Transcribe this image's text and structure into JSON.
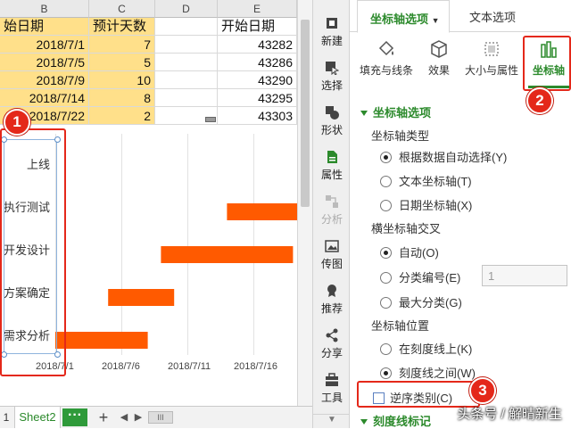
{
  "sheet": {
    "columns": [
      "B",
      "C",
      "D",
      "E"
    ],
    "header_row": [
      "始日期",
      "预计天数",
      "",
      "开始日期"
    ],
    "rows": [
      {
        "date": "2018/7/1",
        "days": "7",
        "start": "43282"
      },
      {
        "date": "2018/7/5",
        "days": "5",
        "start": "43286"
      },
      {
        "date": "2018/7/9",
        "days": "10",
        "start": "43290"
      },
      {
        "date": "2018/7/14",
        "days": "8",
        "start": "43295"
      },
      {
        "date": "2018/7/22",
        "days": "2",
        "start": "43303"
      }
    ],
    "tabs": {
      "tab1": "1",
      "tab2": "Sheet2",
      "more": "···",
      "add": "+",
      "scroll_thumb": "III"
    }
  },
  "chart_data": {
    "type": "bar",
    "orientation": "horizontal-gantt",
    "categories": [
      "上线",
      "执行测试",
      "开发设计",
      "方案确定",
      "需求分析"
    ],
    "x_ticks": [
      "2018/7/1",
      "2018/7/6",
      "2018/7/11",
      "2018/7/16"
    ],
    "series": [
      {
        "values": [
          {
            "category": "上线",
            "start": null,
            "end": null
          },
          {
            "category": "执行测试",
            "start": "2018/7/14",
            "end": "2018/7/22+"
          },
          {
            "category": "开发设计",
            "start": "2018/7/9",
            "end": "2018/7/19+"
          },
          {
            "category": "方案确定",
            "start": "2018/7/5",
            "end": "2018/7/10"
          },
          {
            "category": "需求分析",
            "start": "2018/7/1",
            "end": "2018/7/8"
          }
        ]
      }
    ],
    "bar_color": "#ff5a00",
    "xlim": [
      "2018/6/28",
      "2018/7/20"
    ]
  },
  "gantt_bars": [
    {
      "cat": "执行测试",
      "start_day": 14,
      "end_day": 22
    },
    {
      "cat": "开发设计",
      "start_day": 9,
      "end_day": 19
    },
    {
      "cat": "方案确定",
      "start_day": 5,
      "end_day": 10
    },
    {
      "cat": "需求分析",
      "start_day": 1,
      "end_day": 8
    }
  ],
  "toolbar": {
    "items": [
      {
        "label": "新建",
        "icon": "new-icon"
      },
      {
        "label": "选择",
        "icon": "select-icon"
      },
      {
        "label": "形状",
        "icon": "shape-icon"
      },
      {
        "label": "属性",
        "icon": "property-icon"
      },
      {
        "label": "分析",
        "icon": "analysis-icon"
      },
      {
        "label": "传图",
        "icon": "image-upload-icon"
      },
      {
        "label": "推荐",
        "icon": "recommend-icon"
      },
      {
        "label": "分享",
        "icon": "share-icon"
      },
      {
        "label": "工具",
        "icon": "tools-icon"
      }
    ]
  },
  "panel": {
    "tab_active": "坐标轴选项",
    "tab_other": "文本选项",
    "icon_tabs": [
      "填充与线条",
      "效果",
      "大小与属性",
      "坐标轴"
    ],
    "section_axis_options": "坐标轴选项",
    "axis_type_label": "坐标轴类型",
    "axis_type_options": [
      "根据数据自动选择(Y)",
      "文本坐标轴(T)",
      "日期坐标轴(X)"
    ],
    "cross_label": "横坐标轴交叉",
    "cross_options": [
      "自动(O)",
      "分类编号(E)",
      "最大分类(G)"
    ],
    "cross_value": "1",
    "position_label": "坐标轴位置",
    "position_options": [
      "在刻度线上(K)",
      "刻度线之间(W)"
    ],
    "reverse_label": "逆序类别(C)",
    "next_section": "刻度线标记"
  },
  "badges": [
    "1",
    "2",
    "3"
  ],
  "watermark": "头条号 / 解晴新生",
  "colors": {
    "accent": "#2c8a2c",
    "bar": "#ff5a00",
    "highlight": "#e4281a",
    "cell_yellow": "#ffe08a"
  }
}
